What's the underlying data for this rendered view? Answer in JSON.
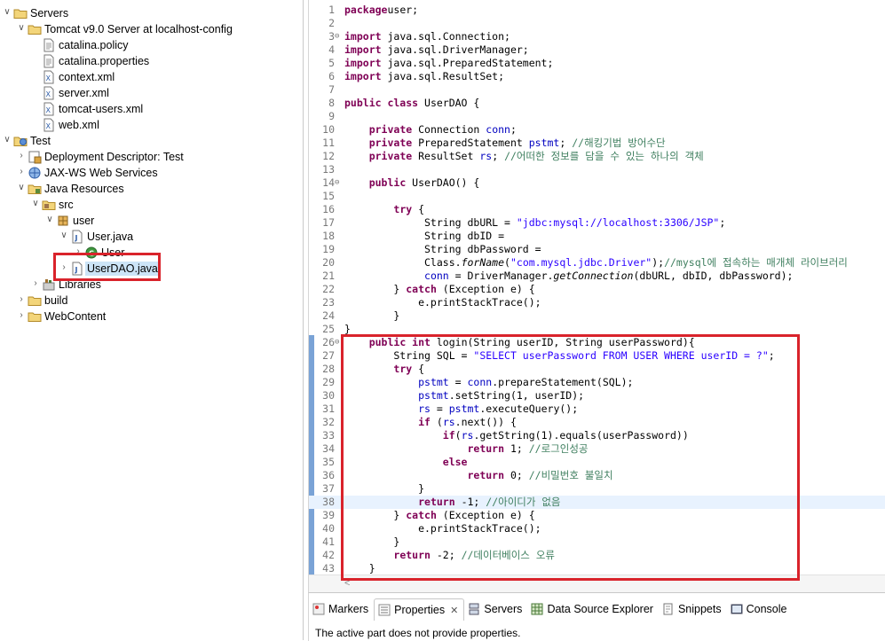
{
  "explorer": {
    "items": [
      {
        "label": "Servers",
        "depth": 0,
        "twisty": "open",
        "icon": "folder-icon"
      },
      {
        "label": "Tomcat v9.0 Server at localhost-config",
        "depth": 1,
        "twisty": "open",
        "icon": "folder-icon"
      },
      {
        "label": "catalina.policy",
        "depth": 2,
        "twisty": "",
        "icon": "text-file-icon"
      },
      {
        "label": "catalina.properties",
        "depth": 2,
        "twisty": "",
        "icon": "text-file-icon"
      },
      {
        "label": "context.xml",
        "depth": 2,
        "twisty": "",
        "icon": "xml-file-icon"
      },
      {
        "label": "server.xml",
        "depth": 2,
        "twisty": "",
        "icon": "xml-file-icon"
      },
      {
        "label": "tomcat-users.xml",
        "depth": 2,
        "twisty": "",
        "icon": "xml-file-icon"
      },
      {
        "label": "web.xml",
        "depth": 2,
        "twisty": "",
        "icon": "xml-file-icon"
      },
      {
        "label": "Test",
        "depth": 0,
        "twisty": "open",
        "icon": "web-project-icon"
      },
      {
        "label": "Deployment Descriptor: Test",
        "depth": 1,
        "twisty": "closed",
        "icon": "deployment-descriptor-icon"
      },
      {
        "label": "JAX-WS Web Services",
        "depth": 1,
        "twisty": "closed",
        "icon": "web-services-icon"
      },
      {
        "label": "Java Resources",
        "depth": 1,
        "twisty": "open",
        "icon": "java-resources-icon"
      },
      {
        "label": "src",
        "depth": 2,
        "twisty": "open",
        "icon": "source-folder-icon"
      },
      {
        "label": "user",
        "depth": 3,
        "twisty": "open",
        "icon": "package-icon"
      },
      {
        "label": "User.java",
        "depth": 4,
        "twisty": "open",
        "icon": "java-file-icon"
      },
      {
        "label": "User",
        "depth": 5,
        "twisty": "closed",
        "icon": "class-icon"
      },
      {
        "label": "UserDAO.java",
        "depth": 4,
        "twisty": "closed",
        "icon": "java-file-icon",
        "selected": true
      },
      {
        "label": "Libraries",
        "depth": 2,
        "twisty": "closed",
        "icon": "library-icon"
      },
      {
        "label": "build",
        "depth": 1,
        "twisty": "closed",
        "icon": "folder-icon"
      },
      {
        "label": "WebContent",
        "depth": 1,
        "twisty": "closed",
        "icon": "folder-icon"
      }
    ]
  },
  "editor": {
    "current_line": 38,
    "lines": [
      {
        "n": "1",
        "fold": "",
        "segs": [
          [
            "kw",
            "package"
          ],
          [
            "",
            "user;"
          ]
        ]
      },
      {
        "n": "2",
        "fold": "",
        "segs": []
      },
      {
        "n": "3",
        "fold": "⊖",
        "segs": [
          [
            "kw",
            "import"
          ],
          [
            "",
            " java.sql.Connection;"
          ]
        ]
      },
      {
        "n": "4",
        "fold": "",
        "segs": [
          [
            "kw",
            "import"
          ],
          [
            "",
            " java.sql.DriverManager;"
          ]
        ]
      },
      {
        "n": "5",
        "fold": "",
        "segs": [
          [
            "kw",
            "import"
          ],
          [
            "",
            " java.sql.PreparedStatement;"
          ]
        ]
      },
      {
        "n": "6",
        "fold": "",
        "segs": [
          [
            "kw",
            "import"
          ],
          [
            "",
            " java.sql.ResultSet;"
          ]
        ]
      },
      {
        "n": "7",
        "fold": "",
        "segs": []
      },
      {
        "n": "8",
        "fold": "",
        "segs": [
          [
            "kw",
            "public class"
          ],
          [
            "",
            " UserDAO {"
          ]
        ]
      },
      {
        "n": "9",
        "fold": "",
        "segs": []
      },
      {
        "n": "10",
        "fold": "",
        "segs": [
          [
            "",
            "    "
          ],
          [
            "kw",
            "private"
          ],
          [
            "",
            " Connection "
          ],
          [
            "fld",
            "conn"
          ],
          [
            "",
            ";"
          ]
        ]
      },
      {
        "n": "11",
        "fold": "",
        "segs": [
          [
            "",
            "    "
          ],
          [
            "kw",
            "private"
          ],
          [
            "",
            " PreparedStatement "
          ],
          [
            "fld",
            "pstmt"
          ],
          [
            "",
            "; "
          ],
          [
            "cm",
            "//해킹기법 방어수단"
          ]
        ]
      },
      {
        "n": "12",
        "fold": "",
        "segs": [
          [
            "",
            "    "
          ],
          [
            "kw",
            "private"
          ],
          [
            "",
            " ResultSet "
          ],
          [
            "fld",
            "rs"
          ],
          [
            "",
            "; "
          ],
          [
            "cm",
            "//어떠한 정보를 담을 수 있는 하나의 객체"
          ]
        ]
      },
      {
        "n": "13",
        "fold": "",
        "segs": []
      },
      {
        "n": "14",
        "fold": "⊖",
        "segs": [
          [
            "",
            "    "
          ],
          [
            "kw",
            "public"
          ],
          [
            "",
            " UserDAO() {"
          ]
        ]
      },
      {
        "n": "15",
        "fold": "",
        "segs": []
      },
      {
        "n": "16",
        "fold": "",
        "segs": [
          [
            "",
            "        "
          ],
          [
            "kw",
            "try"
          ],
          [
            "",
            " {"
          ]
        ]
      },
      {
        "n": "17",
        "fold": "",
        "segs": [
          [
            "",
            "             String dbURL = "
          ],
          [
            "str",
            "\"jdbc:mysql://localhost:3306/JSP\""
          ],
          [
            "",
            ";"
          ]
        ]
      },
      {
        "n": "18",
        "fold": "",
        "segs": [
          [
            "",
            "             String dbID ="
          ]
        ]
      },
      {
        "n": "19",
        "fold": "",
        "segs": [
          [
            "",
            "             String dbPassword ="
          ]
        ]
      },
      {
        "n": "20",
        "fold": "",
        "segs": [
          [
            "",
            "             Class."
          ],
          [
            "st",
            "forName"
          ],
          [
            "",
            "("
          ],
          [
            "str",
            "\"com.mysql.jdbc.Driver\""
          ],
          [
            "",
            ");"
          ],
          [
            "cm",
            "//mysql에 접속하는 매개체 라이브러리"
          ]
        ]
      },
      {
        "n": "21",
        "fold": "",
        "segs": [
          [
            "",
            "             "
          ],
          [
            "fld",
            "conn"
          ],
          [
            "",
            " = DriverManager."
          ],
          [
            "st",
            "getConnection"
          ],
          [
            "",
            "(dbURL, dbID, dbPassword);"
          ]
        ]
      },
      {
        "n": "22",
        "fold": "",
        "segs": [
          [
            "",
            "        } "
          ],
          [
            "kw",
            "catch"
          ],
          [
            "",
            " (Exception e) {"
          ]
        ]
      },
      {
        "n": "23",
        "fold": "",
        "segs": [
          [
            "",
            "            e.printStackTrace();"
          ]
        ]
      },
      {
        "n": "24",
        "fold": "",
        "segs": [
          [
            "",
            "        }"
          ]
        ]
      },
      {
        "n": "25",
        "fold": "",
        "segs": [
          [
            "",
            "}"
          ]
        ]
      },
      {
        "n": "26",
        "fold": "⊖",
        "segs": [
          [
            "",
            "    "
          ],
          [
            "kw",
            "public int"
          ],
          [
            "",
            " login(String userID, String userPassword){"
          ]
        ]
      },
      {
        "n": "27",
        "fold": "",
        "segs": [
          [
            "",
            "        String SQL = "
          ],
          [
            "str",
            "\"SELECT userPassword FROM USER WHERE userID = ?\""
          ],
          [
            "",
            ";"
          ]
        ]
      },
      {
        "n": "28",
        "fold": "",
        "segs": [
          [
            "",
            "        "
          ],
          [
            "kw",
            "try"
          ],
          [
            "",
            " {"
          ]
        ]
      },
      {
        "n": "29",
        "fold": "",
        "segs": [
          [
            "",
            "            "
          ],
          [
            "fld",
            "pstmt"
          ],
          [
            "",
            " = "
          ],
          [
            "fld",
            "conn"
          ],
          [
            "",
            ".prepareStatement(SQL);"
          ]
        ]
      },
      {
        "n": "30",
        "fold": "",
        "segs": [
          [
            "",
            "            "
          ],
          [
            "fld",
            "pstmt"
          ],
          [
            "",
            ".setString(1, userID);"
          ]
        ]
      },
      {
        "n": "31",
        "fold": "",
        "segs": [
          [
            "",
            "            "
          ],
          [
            "fld",
            "rs"
          ],
          [
            "",
            " = "
          ],
          [
            "fld",
            "pstmt"
          ],
          [
            "",
            ".executeQuery();"
          ]
        ]
      },
      {
        "n": "32",
        "fold": "",
        "segs": [
          [
            "",
            "            "
          ],
          [
            "kw",
            "if"
          ],
          [
            "",
            " ("
          ],
          [
            "fld",
            "rs"
          ],
          [
            "",
            ".next()) {"
          ]
        ]
      },
      {
        "n": "33",
        "fold": "",
        "segs": [
          [
            "",
            "                "
          ],
          [
            "kw",
            "if"
          ],
          [
            "",
            "("
          ],
          [
            "fld",
            "rs"
          ],
          [
            "",
            ".getString(1).equals(userPassword))"
          ]
        ]
      },
      {
        "n": "34",
        "fold": "",
        "segs": [
          [
            "",
            "                    "
          ],
          [
            "kw",
            "return"
          ],
          [
            "",
            " 1; "
          ],
          [
            "cm",
            "//로그인성공"
          ]
        ]
      },
      {
        "n": "35",
        "fold": "",
        "segs": [
          [
            "",
            "                "
          ],
          [
            "kw",
            "else"
          ]
        ]
      },
      {
        "n": "36",
        "fold": "",
        "segs": [
          [
            "",
            "                    "
          ],
          [
            "kw",
            "return"
          ],
          [
            "",
            " 0; "
          ],
          [
            "cm",
            "//비밀번호 불일치"
          ]
        ]
      },
      {
        "n": "37",
        "fold": "",
        "segs": [
          [
            "",
            "            }"
          ]
        ]
      },
      {
        "n": "38",
        "fold": "",
        "segs": [
          [
            "",
            "            "
          ],
          [
            "kw",
            "return"
          ],
          [
            "",
            " -1; "
          ],
          [
            "cm",
            "//아이디가 없음"
          ]
        ]
      },
      {
        "n": "39",
        "fold": "",
        "segs": [
          [
            "",
            "        } "
          ],
          [
            "kw",
            "catch"
          ],
          [
            "",
            " (Exception e) {"
          ]
        ]
      },
      {
        "n": "40",
        "fold": "",
        "segs": [
          [
            "",
            "            e.printStackTrace();"
          ]
        ]
      },
      {
        "n": "41",
        "fold": "",
        "segs": [
          [
            "",
            "        }"
          ]
        ]
      },
      {
        "n": "42",
        "fold": "",
        "segs": [
          [
            "",
            "        "
          ],
          [
            "kw",
            "return"
          ],
          [
            "",
            " -2; "
          ],
          [
            "cm",
            "//데이터베이스 오류"
          ]
        ]
      },
      {
        "n": "43",
        "fold": "",
        "segs": [
          [
            "",
            "    }"
          ]
        ]
      }
    ]
  },
  "bottom_panel": {
    "tabs": [
      {
        "label": "Markers",
        "icon": "markers-icon",
        "active": false,
        "close": ""
      },
      {
        "label": "Properties",
        "icon": "properties-icon",
        "active": true,
        "close": "✕"
      },
      {
        "label": "Servers",
        "icon": "servers-icon",
        "active": false,
        "close": ""
      },
      {
        "label": "Data Source Explorer",
        "icon": "data-source-explorer-icon",
        "active": false,
        "close": ""
      },
      {
        "label": "Snippets",
        "icon": "snippets-icon",
        "active": false,
        "close": ""
      },
      {
        "label": "Console",
        "icon": "console-icon",
        "active": false,
        "close": ""
      }
    ],
    "message": "The active part does not provide properties."
  },
  "colors": {
    "highlight_red": "#d9232b",
    "keyword": "#7f0055",
    "string": "#2a00ff",
    "comment": "#3f7f5f",
    "field": "#0000c0",
    "selection": "#cce4f7"
  }
}
